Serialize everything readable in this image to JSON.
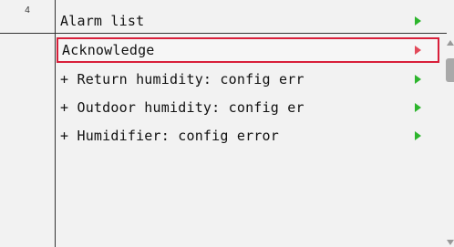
{
  "index_number": "4",
  "menu": {
    "title": "Alarm list",
    "items": [
      {
        "label": "Acknowledge",
        "selected": true,
        "arrow_color": "#e24a5a"
      },
      {
        "label": "+ Return humidity: config err",
        "selected": false,
        "arrow_color": "#2db52d"
      },
      {
        "label": "+ Outdoor humidity: config er",
        "selected": false,
        "arrow_color": "#2db52d"
      },
      {
        "label": "+ Humidifier: config error",
        "selected": false,
        "arrow_color": "#2db52d"
      }
    ]
  },
  "colors": {
    "background": "#f2f2f2",
    "selection_border": "#d81f3a",
    "arrow_green": "#2db52d",
    "arrow_red": "#e24a5a"
  },
  "icons": {
    "row_arrow": "chevron-right-icon",
    "scroll_up": "scroll-up-icon",
    "scroll_down": "scroll-down-icon"
  }
}
